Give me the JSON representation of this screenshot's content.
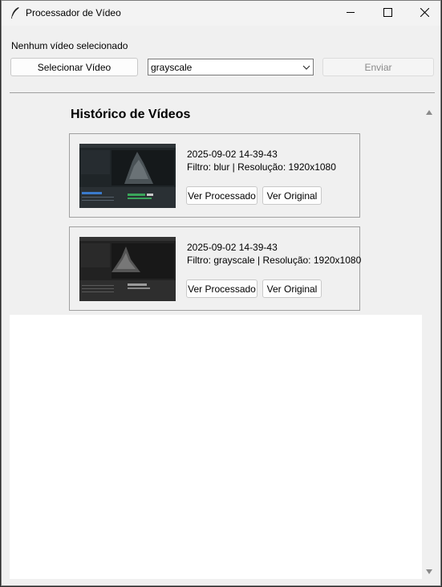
{
  "window": {
    "title": "Processador de Vídeo"
  },
  "top": {
    "status_label": "Nenhum vídeo selecionado",
    "select_button": "Selecionar Vídeo",
    "filter_selected": "grayscale",
    "send_button": "Enviar"
  },
  "history": {
    "title": "Histórico de Vídeos",
    "items": [
      {
        "date": "2025-09-02 14-39-43",
        "info": "Filtro: blur | Resolução: 1920x1080",
        "processed_button": "Ver Processado",
        "original_button": "Ver Original"
      },
      {
        "date": "2025-09-02 14-39-43",
        "info": "Filtro: grayscale | Resolução: 1920x1080",
        "processed_button": "Ver Processado",
        "original_button": "Ver Original"
      }
    ]
  },
  "icons": {
    "app": "feather-icon",
    "minimize": "minimize-icon",
    "maximize": "maximize-icon",
    "close": "close-icon",
    "combo": "chevron-down-icon",
    "scroll_up": "scroll-up-icon",
    "scroll_down": "scroll-down-icon"
  },
  "colors": {
    "window_bg": "#f0f0f0",
    "disabled_text": "#8a8a8a",
    "thumb_bg": "#1d2326"
  }
}
